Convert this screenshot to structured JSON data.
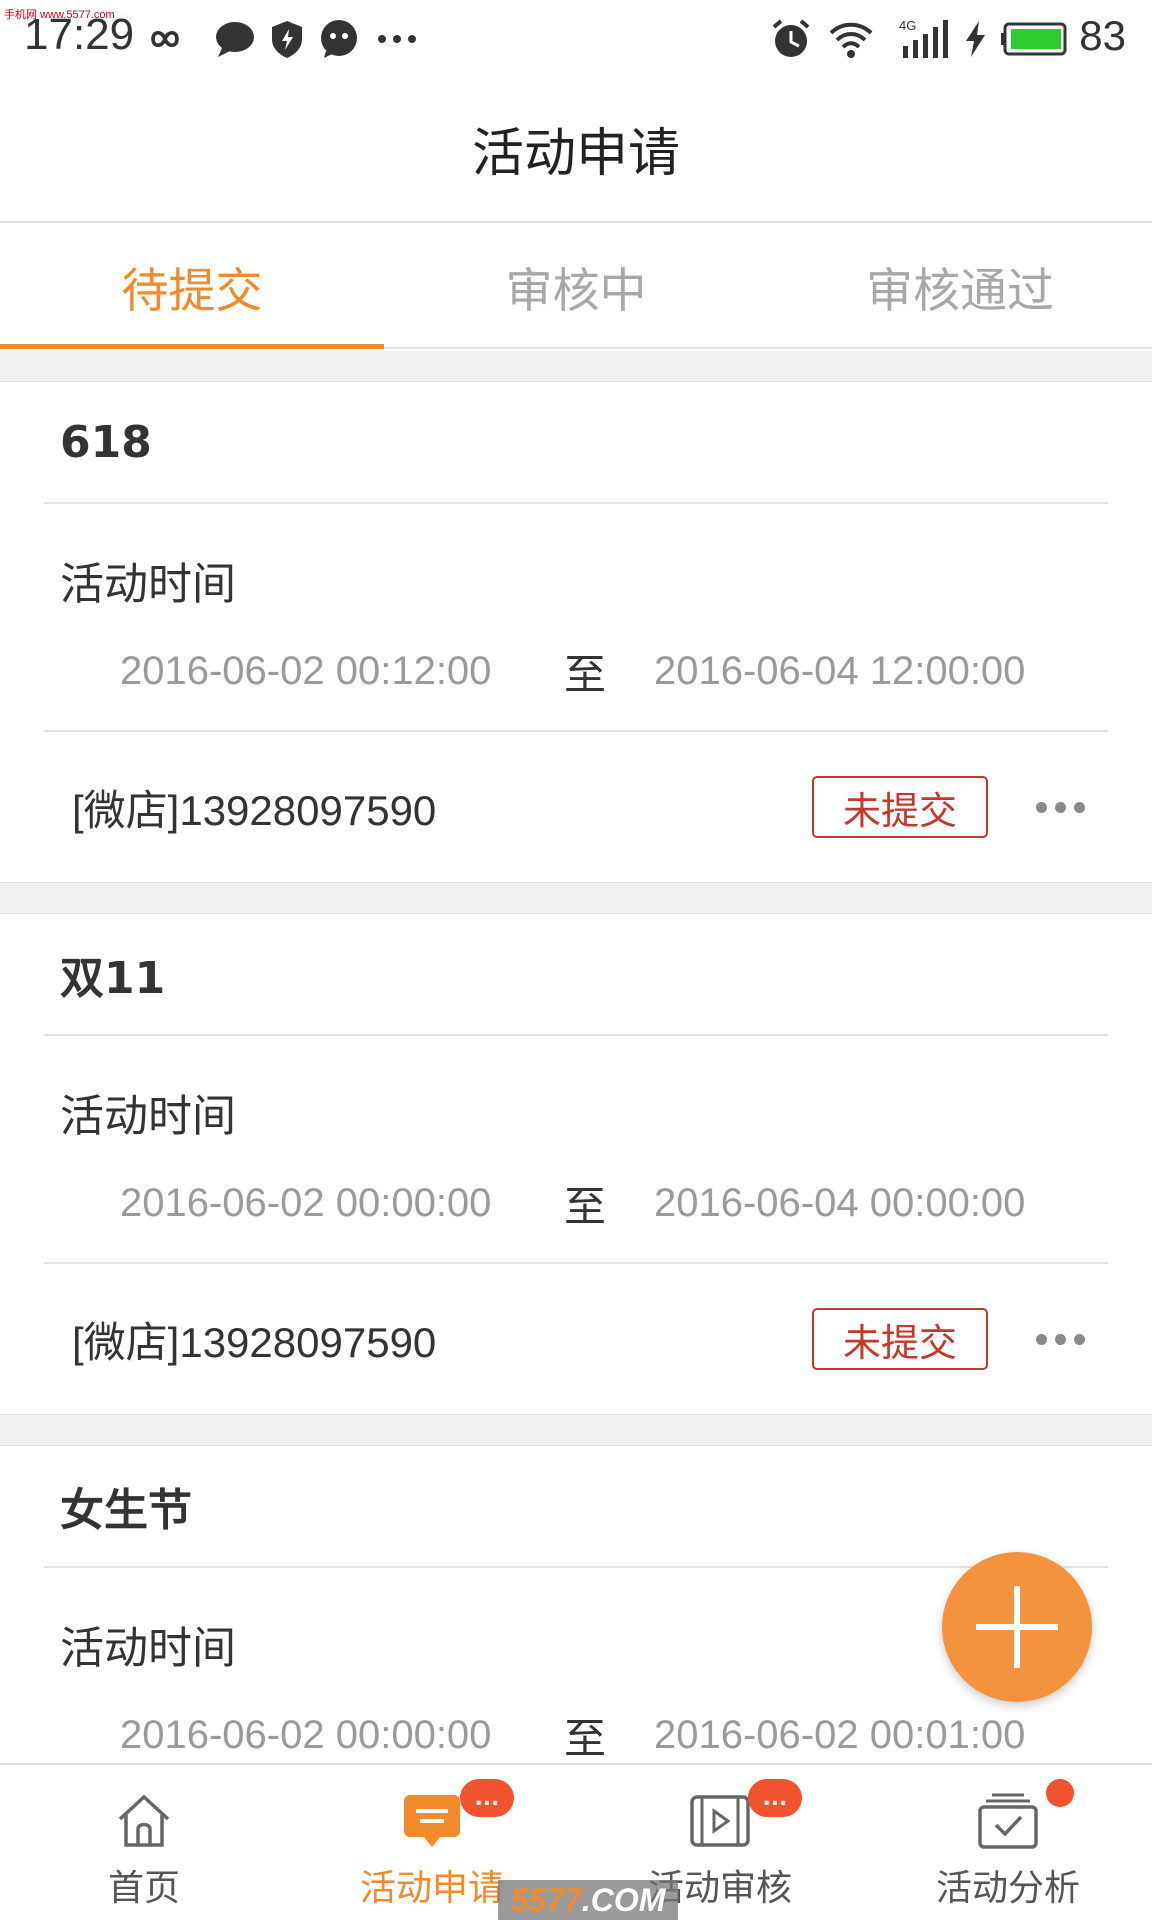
{
  "status_bar": {
    "time": "17:29",
    "battery": "83",
    "network": "4G",
    "icons": [
      "infinity-icon",
      "chat-bubble-icon",
      "shield-icon",
      "message-icon",
      "more-dots-icon",
      "alarm-icon",
      "wifi-icon",
      "signal-icon",
      "charging-icon",
      "battery-icon"
    ],
    "watermark": "手机网 www.5577.com"
  },
  "header": {
    "title": "活动申请"
  },
  "tabs": [
    {
      "label": "待提交",
      "active": true
    },
    {
      "label": "审核中",
      "active": false
    },
    {
      "label": "审核通过",
      "active": false
    }
  ],
  "cards": [
    {
      "title": "618",
      "time_label": "活动时间",
      "start": "2016-06-02 00:12:00",
      "separator": "至",
      "end": "2016-06-04 12:00:00",
      "shop": "[微店]13928097590",
      "status": "未提交"
    },
    {
      "title": "双11",
      "time_label": "活动时间",
      "start": "2016-06-02 00:00:00",
      "separator": "至",
      "end": "2016-06-04 00:00:00",
      "shop": "[微店]13928097590",
      "status": "未提交"
    },
    {
      "title": "女生节",
      "time_label": "活动时间",
      "start": "2016-06-02 00:00:00",
      "separator": "至",
      "end": "2016-06-02 00:01:00",
      "shop": "",
      "status": ""
    }
  ],
  "fab": {
    "icon": "plus-icon"
  },
  "bottom_nav": [
    {
      "label": "首页",
      "icon": "home-icon",
      "active": false,
      "badge": ""
    },
    {
      "label": "活动申请",
      "icon": "message-list-icon",
      "active": true,
      "badge": "..."
    },
    {
      "label": "活动审核",
      "icon": "video-review-icon",
      "active": false,
      "badge": "..."
    },
    {
      "label": "活动分析",
      "icon": "checklist-icon",
      "active": false,
      "badge": ""
    }
  ],
  "watermark": {
    "num": "5577",
    "suffix": ".COM"
  },
  "colors": {
    "accent": "#f08a2a",
    "status_red": "#c0392b",
    "badge": "#f0532e"
  }
}
